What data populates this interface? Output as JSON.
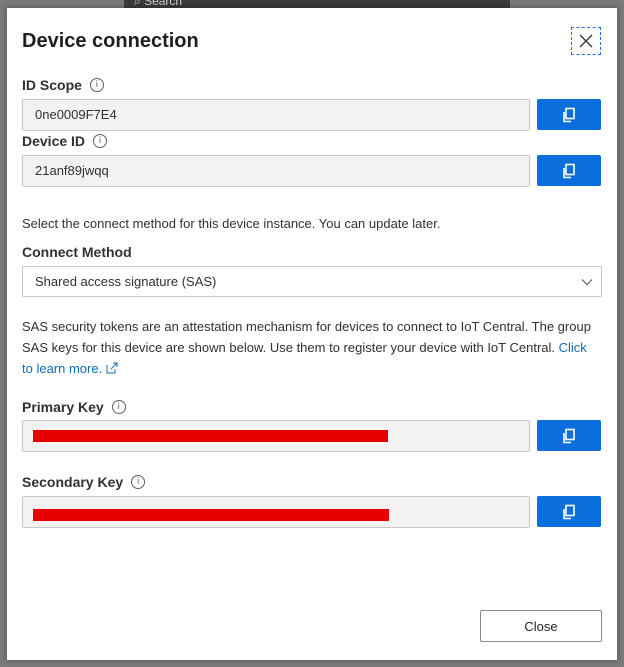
{
  "backdrop": {
    "search_text": "Search"
  },
  "dialog": {
    "title": "Device connection",
    "id_scope": {
      "label": "ID Scope",
      "value": "0ne0009F7E4"
    },
    "device_id": {
      "label": "Device ID",
      "value": "21anf89jwqq"
    },
    "select_text": "Select the connect method for this device instance. You can update later.",
    "connect_method": {
      "label": "Connect Method",
      "selected": "Shared access signature (SAS)"
    },
    "sas_text": "SAS security tokens are an attestation mechanism for devices to connect to IoT Central. The group SAS keys for this device are shown below. Use them to register your device with IoT Central.",
    "learn_more": "Click to learn more.",
    "primary_key": {
      "label": "Primary Key"
    },
    "secondary_key": {
      "label": "Secondary Key"
    },
    "close_label": "Close"
  },
  "icons": {
    "info": "info-icon",
    "copy": "copy-icon",
    "close": "close-icon",
    "chevron": "chevron-down-icon",
    "external": "external-link-icon"
  },
  "colors": {
    "accent": "#0a6fdc",
    "redaction": "#e60000",
    "link": "#0f6cbd"
  }
}
